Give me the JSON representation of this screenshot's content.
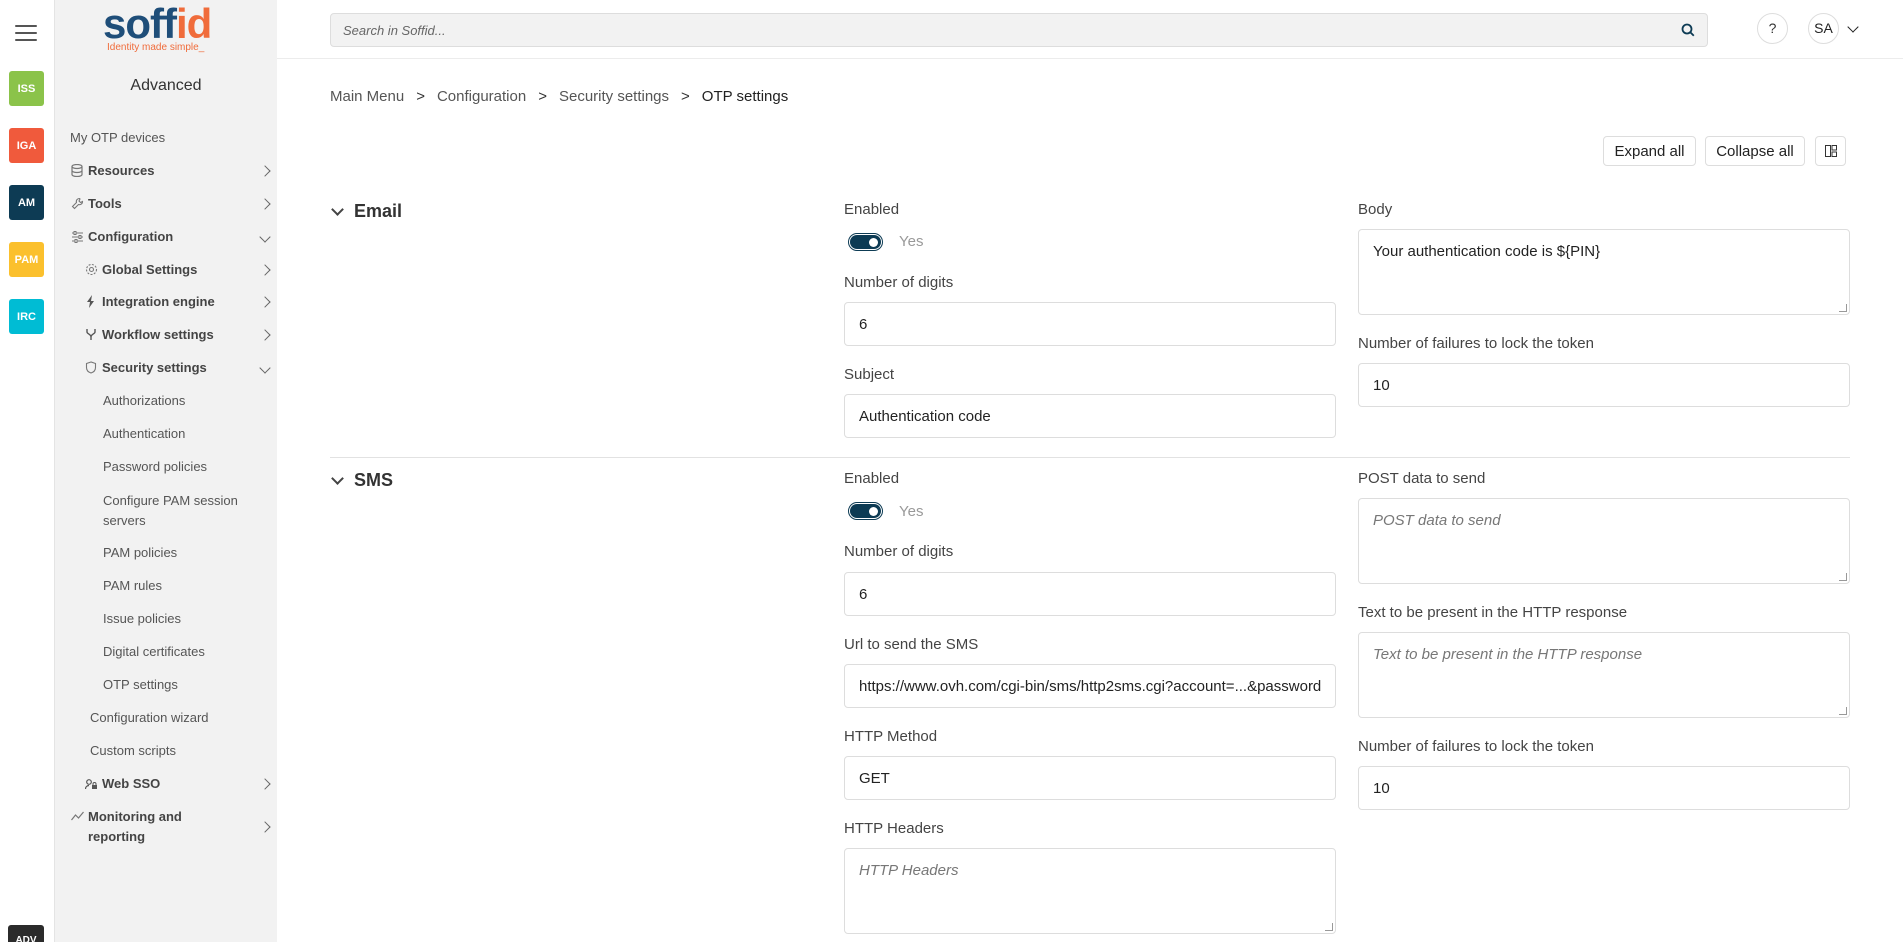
{
  "rail": {
    "apps": [
      {
        "label": "ISS",
        "color": "#8bc34a"
      },
      {
        "label": "IGA",
        "color": "#f05a3c"
      },
      {
        "label": "AM",
        "color": "#0d3b54"
      },
      {
        "label": "PAM",
        "color": "#fbc02d"
      },
      {
        "label": "IRC",
        "color": "#00bcd4"
      }
    ],
    "bottom_app": "ADV"
  },
  "sidebar": {
    "logo_main": "soff",
    "logo_accent": "id",
    "logo_tagline": "Identity made simple_",
    "title": "Advanced",
    "items": [
      {
        "label": "My OTP devices"
      },
      {
        "label": "Resources"
      },
      {
        "label": "Tools"
      },
      {
        "label": "Configuration"
      },
      {
        "label": "Global Settings"
      },
      {
        "label": "Integration engine"
      },
      {
        "label": "Workflow settings"
      },
      {
        "label": "Security settings"
      },
      {
        "label": "Authorizations"
      },
      {
        "label": "Authentication"
      },
      {
        "label": "Password policies"
      },
      {
        "label": "Configure PAM session servers"
      },
      {
        "label": "PAM policies"
      },
      {
        "label": "PAM rules"
      },
      {
        "label": "Issue policies"
      },
      {
        "label": "Digital certificates"
      },
      {
        "label": "OTP settings"
      },
      {
        "label": "Configuration wizard"
      },
      {
        "label": "Custom scripts"
      },
      {
        "label": "Web SSO"
      },
      {
        "label": "Monitoring and reporting"
      }
    ]
  },
  "header": {
    "search_placeholder": "Search in Soffid...",
    "help_label": "?",
    "user_initials": "SA"
  },
  "breadcrumb": {
    "items": [
      "Main Menu",
      "Configuration",
      "Security settings",
      "OTP settings"
    ],
    "separator": ">"
  },
  "toolbar": {
    "expand_label": "Expand all",
    "collapse_label": "Collapse all"
  },
  "email": {
    "title": "Email",
    "enabled_label": "Enabled",
    "enabled_value": "Yes",
    "digits_label": "Number of digits",
    "digits_value": "6",
    "subject_label": "Subject",
    "subject_value": "Authentication code",
    "body_label": "Body",
    "body_value": "Your authentication code is ${PIN}",
    "failures_label": "Number of failures to lock the token",
    "failures_value": "10"
  },
  "sms": {
    "title": "SMS",
    "enabled_label": "Enabled",
    "enabled_value": "Yes",
    "digits_label": "Number of digits",
    "digits_value": "6",
    "url_label": "Url to send the SMS",
    "url_value": "https://www.ovh.com/cgi-bin/sms/http2sms.cgi?account=...&password",
    "method_label": "HTTP Method",
    "method_value": "GET",
    "headers_label": "HTTP Headers",
    "headers_placeholder": "HTTP Headers",
    "post_label": "POST data to send",
    "post_placeholder": "POST data to send",
    "response_label": "Text to be present in the HTTP response",
    "response_placeholder": "Text to be present in the HTTP response",
    "failures_label": "Number of failures to lock the token",
    "failures_value": "10"
  }
}
